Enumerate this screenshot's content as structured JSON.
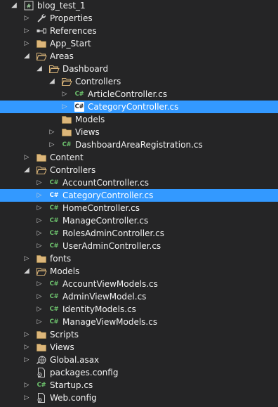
{
  "solution_explorer": {
    "items": [
      {
        "label": "blog_test_1",
        "depth": 0,
        "arrow": "open",
        "icon": "csharp-project-icon"
      },
      {
        "label": "Properties",
        "depth": 1,
        "arrow": "closed",
        "icon": "wrench-icon"
      },
      {
        "label": "References",
        "depth": 1,
        "arrow": "closed",
        "icon": "references-icon"
      },
      {
        "label": "App_Start",
        "depth": 1,
        "arrow": "closed",
        "icon": "folder-icon"
      },
      {
        "label": "Areas",
        "depth": 1,
        "arrow": "open",
        "icon": "folder-open-icon"
      },
      {
        "label": "Dashboard",
        "depth": 2,
        "arrow": "open",
        "icon": "folder-open-icon"
      },
      {
        "label": "Controllers",
        "depth": 3,
        "arrow": "open",
        "icon": "folder-open-icon"
      },
      {
        "label": "ArticleController.cs",
        "depth": 4,
        "arrow": "closed",
        "icon": "csharp-file-icon"
      },
      {
        "label": "CategoryController.cs",
        "depth": 4,
        "arrow": "closed",
        "icon": "csharp-file-icon",
        "selected": true
      },
      {
        "label": "Models",
        "depth": 3,
        "arrow": "none",
        "icon": "folder-icon"
      },
      {
        "label": "Views",
        "depth": 3,
        "arrow": "closed",
        "icon": "folder-icon"
      },
      {
        "label": "DashboardAreaRegistration.cs",
        "depth": 3,
        "arrow": "closed",
        "icon": "csharp-file-icon"
      },
      {
        "label": "Content",
        "depth": 1,
        "arrow": "closed",
        "icon": "folder-icon"
      },
      {
        "label": "Controllers",
        "depth": 1,
        "arrow": "open",
        "icon": "folder-open-icon"
      },
      {
        "label": "AccountController.cs",
        "depth": 2,
        "arrow": "closed",
        "icon": "csharp-file-icon"
      },
      {
        "label": "CategoryController.cs",
        "depth": 2,
        "arrow": "closed",
        "icon": "csharp-file-icon",
        "selected": true
      },
      {
        "label": "HomeController.cs",
        "depth": 2,
        "arrow": "closed",
        "icon": "csharp-file-icon"
      },
      {
        "label": "ManageController.cs",
        "depth": 2,
        "arrow": "closed",
        "icon": "csharp-file-icon"
      },
      {
        "label": "RolesAdminController.cs",
        "depth": 2,
        "arrow": "closed",
        "icon": "csharp-file-icon"
      },
      {
        "label": "UserAdminController.cs",
        "depth": 2,
        "arrow": "closed",
        "icon": "csharp-file-icon"
      },
      {
        "label": "fonts",
        "depth": 1,
        "arrow": "closed",
        "icon": "folder-icon"
      },
      {
        "label": "Models",
        "depth": 1,
        "arrow": "open",
        "icon": "folder-open-icon"
      },
      {
        "label": "AccountViewModels.cs",
        "depth": 2,
        "arrow": "closed",
        "icon": "csharp-file-icon"
      },
      {
        "label": "AdminViewModel.cs",
        "depth": 2,
        "arrow": "closed",
        "icon": "csharp-file-icon"
      },
      {
        "label": "IdentityModels.cs",
        "depth": 2,
        "arrow": "closed",
        "icon": "csharp-file-icon"
      },
      {
        "label": "ManageViewModels.cs",
        "depth": 2,
        "arrow": "closed",
        "icon": "csharp-file-icon"
      },
      {
        "label": "Scripts",
        "depth": 1,
        "arrow": "closed",
        "icon": "folder-icon"
      },
      {
        "label": "Views",
        "depth": 1,
        "arrow": "closed",
        "icon": "folder-icon"
      },
      {
        "label": "Global.asax",
        "depth": 1,
        "arrow": "closed",
        "icon": "global-asax-icon"
      },
      {
        "label": "packages.config",
        "depth": 1,
        "arrow": "none",
        "icon": "config-file-icon"
      },
      {
        "label": "Startup.cs",
        "depth": 1,
        "arrow": "closed",
        "icon": "csharp-file-icon"
      },
      {
        "label": "Web.config",
        "depth": 1,
        "arrow": "closed",
        "icon": "config-file-icon"
      }
    ]
  },
  "colors": {
    "background": "#252526",
    "selection": "#3399ff",
    "text": "#f1f1f1",
    "folder": "#dcb67a",
    "csharp": "#6dc26d"
  },
  "icon_glyphs": {
    "csharp_file": "C#"
  }
}
